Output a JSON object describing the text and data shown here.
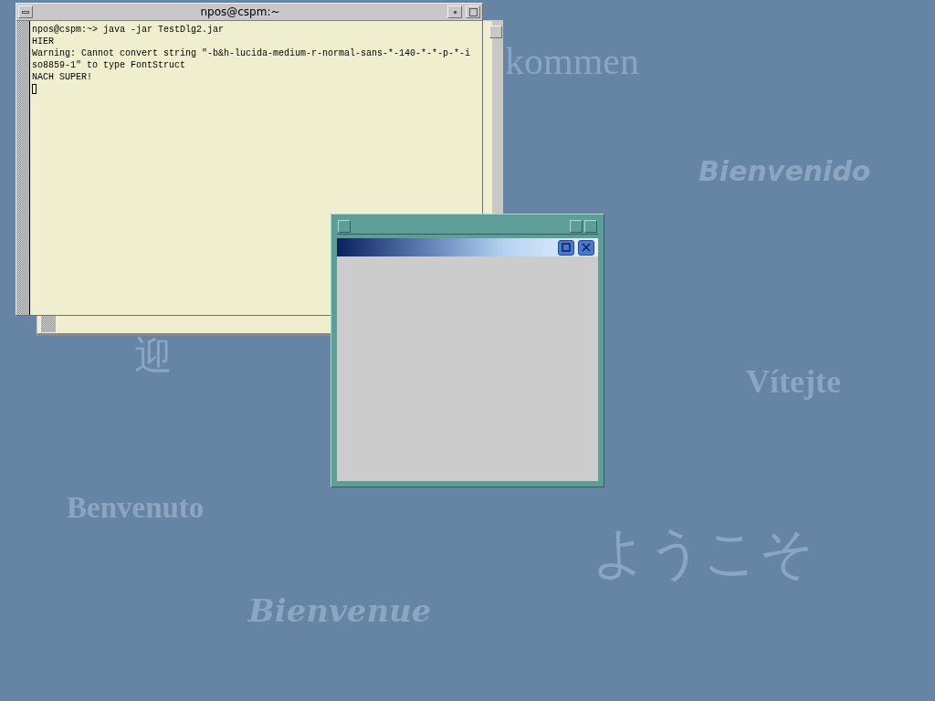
{
  "desktop": {
    "greetings": [
      {
        "text": "kommen"
      },
      {
        "text": "Bienvenido"
      },
      {
        "text": "迎"
      },
      {
        "text": "Vítejte"
      },
      {
        "text": "Benvenuto"
      },
      {
        "text": "ようこそ"
      },
      {
        "text": "Bienvenue"
      }
    ]
  },
  "terminal": {
    "title": "npos@cspm:~",
    "lines": [
      "npos@cspm:~> java -jar TestDlg2.jar",
      "HIER",
      "Warning: Cannot convert string \"-b&h-lucida-medium-r-normal-sans-*-140-*-*-p-*-i",
      "so8859-1\" to type FontStruct",
      "NACH SUPER!"
    ]
  }
}
